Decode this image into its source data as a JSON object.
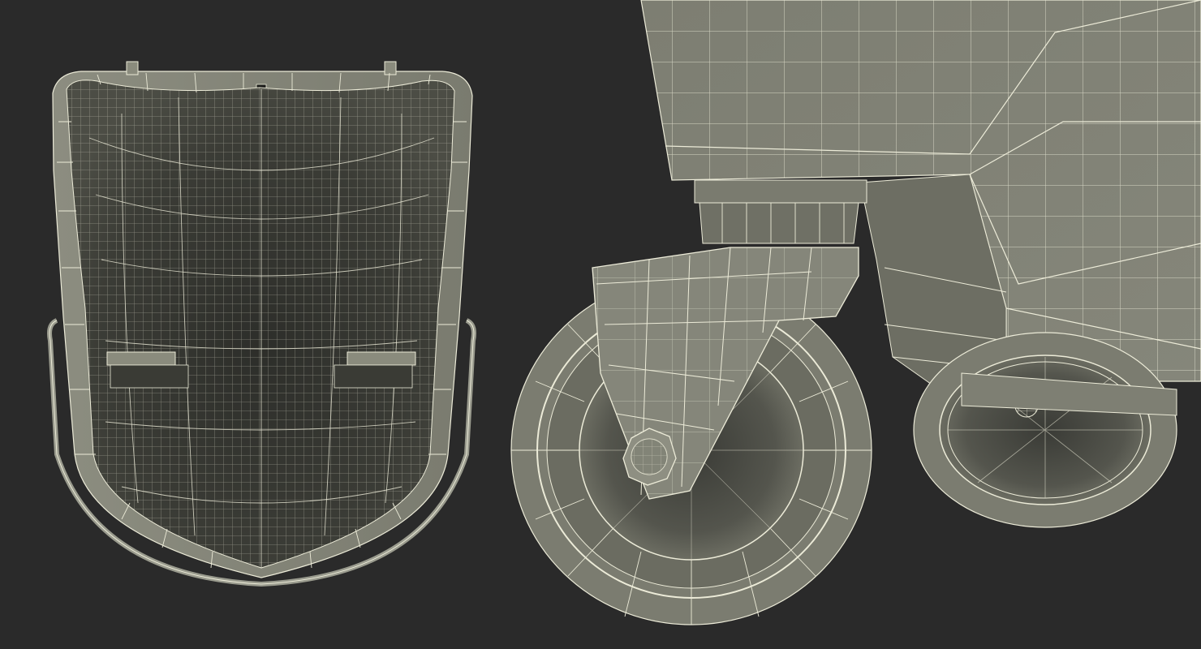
{
  "colors": {
    "background": "#2a2a2a",
    "surface_light": "#8a8b7d",
    "surface_mid": "#6e6f63",
    "surface_dark": "#3e3f39",
    "surface_deep": "#2f302c",
    "wire": "#ecebd8"
  },
  "panels": [
    {
      "name": "bucket-top-view",
      "subject": "bucket-wireframe-top"
    },
    {
      "name": "caster-closeup",
      "subject": "caster-wheel-wireframe"
    }
  ]
}
